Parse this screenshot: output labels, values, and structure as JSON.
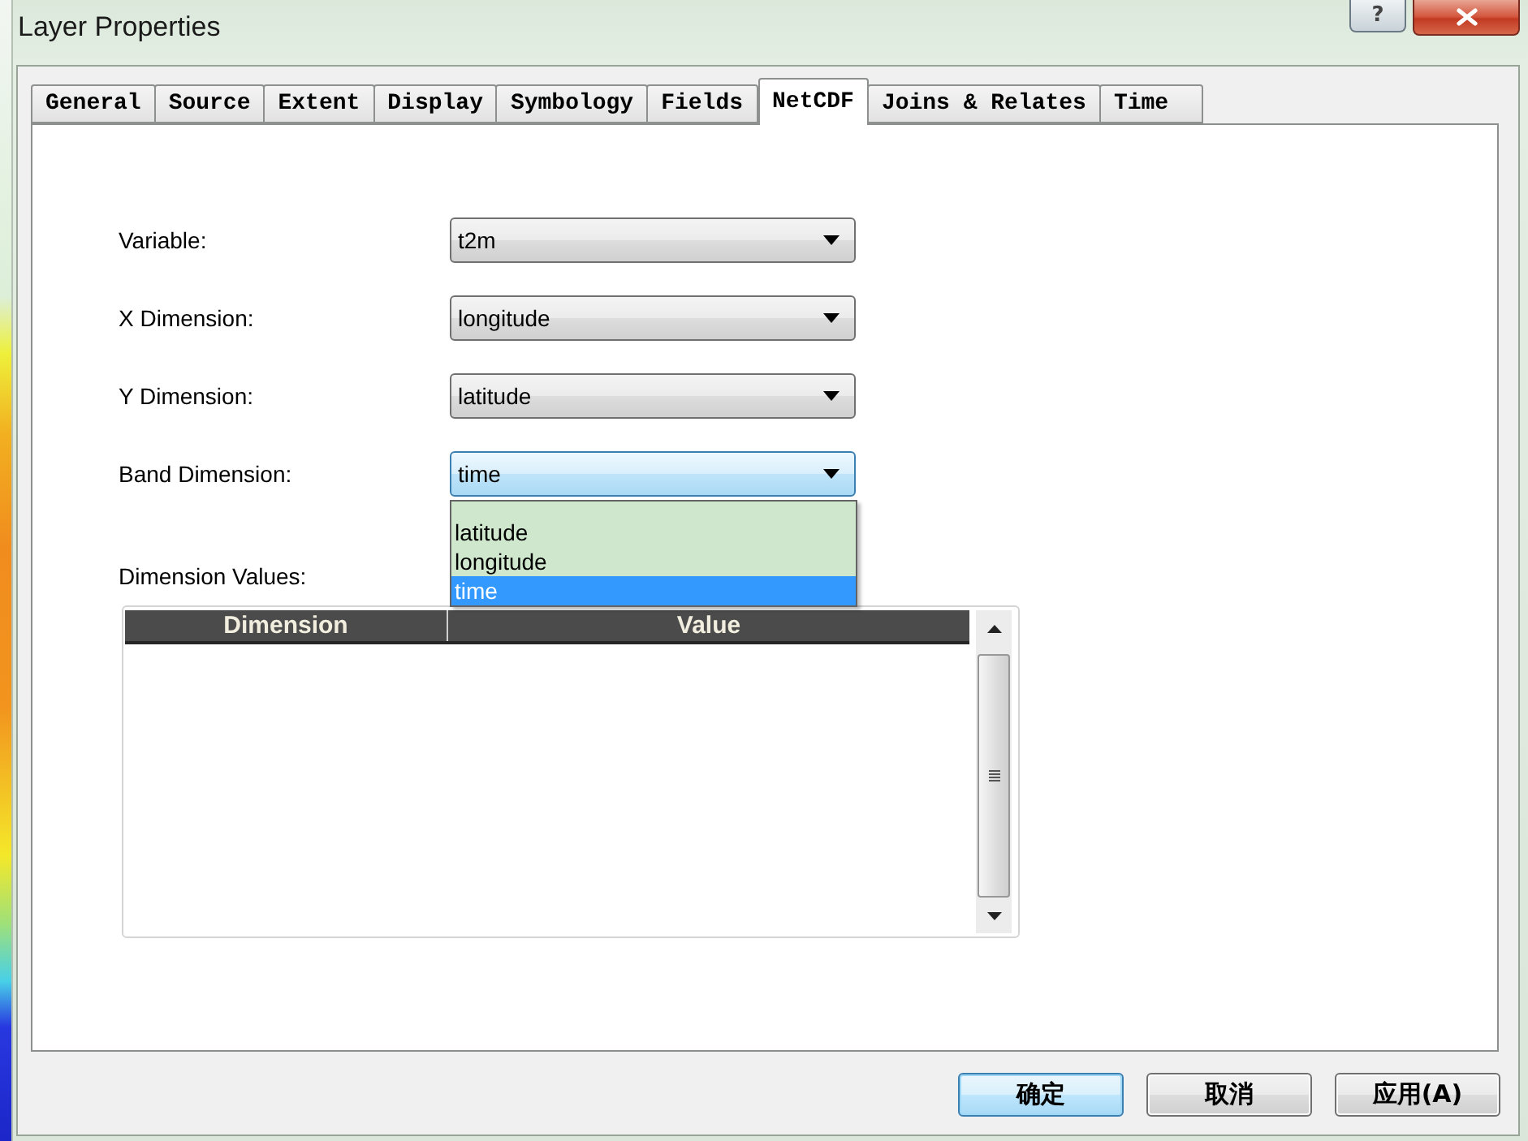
{
  "window": {
    "title": "Layer Properties",
    "help_label": "?"
  },
  "tabs": [
    {
      "label": "General",
      "selected": false
    },
    {
      "label": "Source",
      "selected": false
    },
    {
      "label": "Extent",
      "selected": false
    },
    {
      "label": "Display",
      "selected": false
    },
    {
      "label": "Symbology",
      "selected": false
    },
    {
      "label": "Fields",
      "selected": false
    },
    {
      "label": "NetCDF",
      "selected": true
    },
    {
      "label": "Joins & Relates",
      "selected": false
    },
    {
      "label": "Time",
      "selected": false
    }
  ],
  "netcdf": {
    "fields": [
      {
        "label": "Variable:",
        "value": "t2m",
        "focused": false
      },
      {
        "label": "X Dimension:",
        "value": "longitude",
        "focused": false
      },
      {
        "label": "Y Dimension:",
        "value": "latitude",
        "focused": false
      },
      {
        "label": "Band Dimension:",
        "value": "time",
        "focused": true,
        "expanded": true,
        "options": [
          {
            "label": "latitude",
            "selected": false
          },
          {
            "label": "longitude",
            "selected": false
          },
          {
            "label": "time",
            "selected": true
          }
        ]
      }
    ],
    "dimension_values": {
      "label": "Dimension Values:",
      "columns": [
        "Dimension",
        "Value"
      ]
    }
  },
  "buttons": [
    {
      "label": "确定",
      "default": true
    },
    {
      "label": "取消",
      "default": false
    },
    {
      "label": "应用(A)",
      "default": false
    }
  ]
}
